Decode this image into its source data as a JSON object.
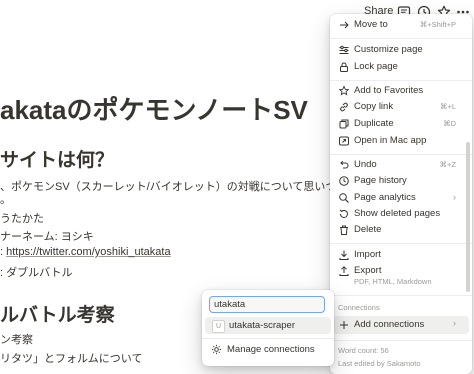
{
  "topbar": {
    "share_label": "Share"
  },
  "page": {
    "title": "akataのポケモンノートSV",
    "heading1": "サイトは何？",
    "line1": "、ポケモンSV（スカーレット/バイオレット）の対戦について思いついたことを",
    "line1b": "。",
    "line2": "うたかた",
    "line3": "ナーネーム: ヨシキ",
    "line4_prefix": ": ",
    "line4_link": "https://twitter.com/yoshiki_utakata",
    "line5": ": ダブルバトル",
    "heading2": "ルバトル考察",
    "line6": "ン考察",
    "line7": "リタツ」とフォルムについて"
  },
  "menu": {
    "move_to": {
      "label": "Move to",
      "shortcut": "⌘+Shift+P"
    },
    "customize": "Customize page",
    "lock": "Lock page",
    "favorites": "Add to Favorites",
    "copy_link": {
      "label": "Copy link",
      "shortcut": "⌘+L"
    },
    "duplicate": {
      "label": "Duplicate",
      "shortcut": "⌘D"
    },
    "open_mac": "Open in Mac app",
    "undo": {
      "label": "Undo",
      "shortcut": "⌘+Z"
    },
    "history": "Page history",
    "analytics": "Page analytics",
    "deleted": "Show deleted pages",
    "delete": "Delete",
    "import": "Import",
    "export": {
      "label": "Export",
      "sub": "PDF, HTML, Markdown"
    },
    "connections_header": "Connections",
    "add_connections": "Add connections",
    "word_count": "Word count: 56",
    "last_edited": "Last edited by Sakamoto"
  },
  "connections_popup": {
    "search_value": "utakata",
    "result": {
      "badge": "U",
      "label": "utakata-scraper"
    },
    "manage": "Manage connections"
  }
}
